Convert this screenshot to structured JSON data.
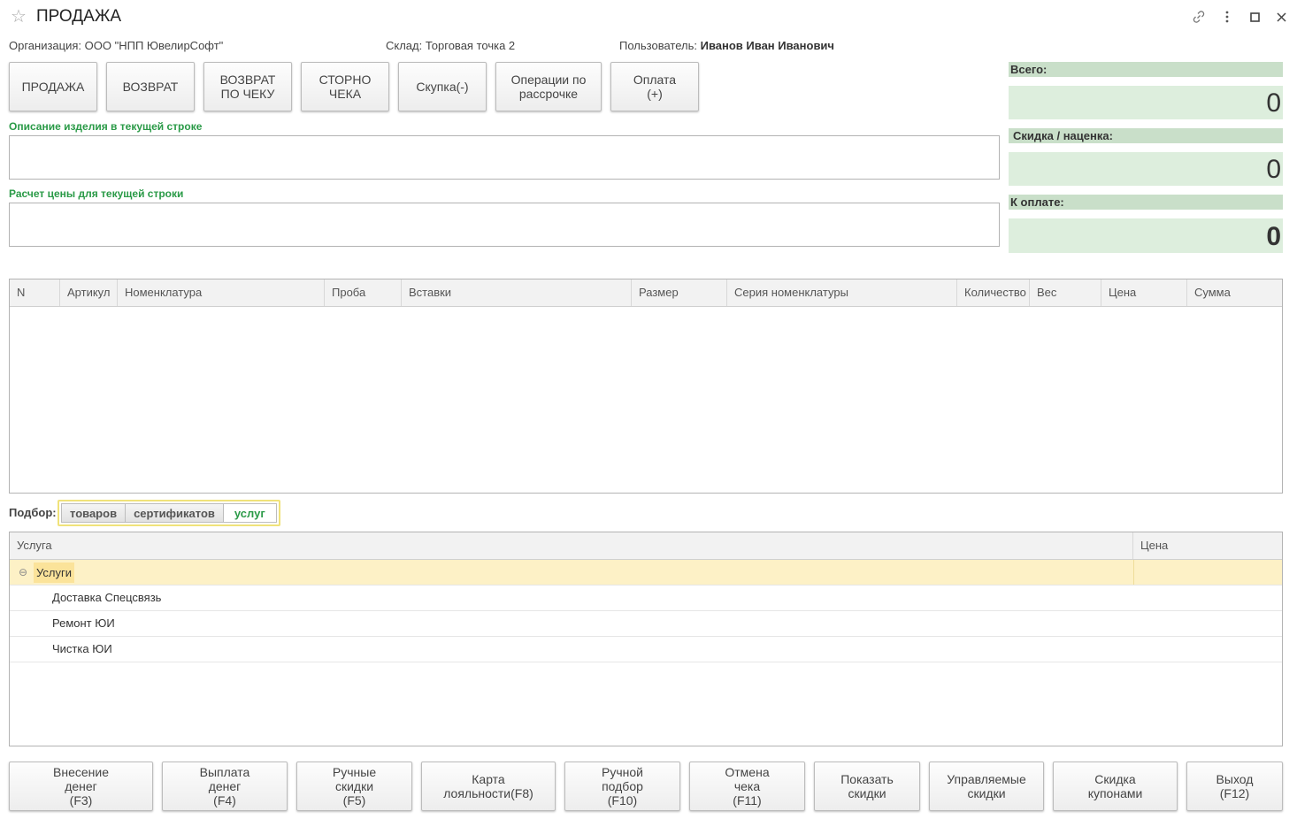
{
  "window": {
    "title": "ПРОДАЖА"
  },
  "info": {
    "org_label": "Организация:",
    "org_value": "ООО \"НПП ЮвелирСофт\"",
    "store_label": "Склад:",
    "store_value": "Торговая точка 2",
    "user_label": "Пользователь:",
    "user_value": "Иванов Иван Иванович"
  },
  "operations": [
    {
      "label": "ПРОДАЖА"
    },
    {
      "label": "ВОЗВРАТ"
    },
    {
      "label": "ВОЗВРАТ\nПО ЧЕКУ"
    },
    {
      "label": "СТОРНО\nЧЕКА"
    },
    {
      "label": "Скупка(-)"
    },
    {
      "label": "Операции по\nрассрочке"
    },
    {
      "label": "Оплата\n(+)"
    }
  ],
  "description": {
    "label": "Описание изделия в текущей строке",
    "value": ""
  },
  "price_calc": {
    "label": "Расчет цены для текущей строки",
    "value": ""
  },
  "totals": {
    "total_label": "Всего:",
    "total_value": "0",
    "discount_label": "Скидка / наценка:",
    "discount_value": "0",
    "to_pay_label": "К оплате:",
    "to_pay_value": "0"
  },
  "items_table": {
    "columns": [
      "N",
      "Артикул",
      "Номенклатура",
      "Проба",
      "Вставки",
      "Размер",
      "Серия номенклатуры",
      "Количество",
      "Вес",
      "Цена",
      "Сумма"
    ],
    "rows": []
  },
  "selection": {
    "label": "Подбор:",
    "tabs": [
      "товаров",
      "сертификатов",
      "услуг"
    ],
    "active_tab": "услуг"
  },
  "services_table": {
    "columns": [
      "Услуга",
      "Цена"
    ],
    "group": {
      "name": "Услуги",
      "expanded": true
    },
    "rows": [
      {
        "name": "Доставка Спецсвязь",
        "price": ""
      },
      {
        "name": "Ремонт ЮИ",
        "price": ""
      },
      {
        "name": "Чистка ЮИ",
        "price": ""
      }
    ]
  },
  "bottom_buttons": [
    {
      "label": "Внесение\nденег\n(F3)"
    },
    {
      "label": "Выплата\nденег\n(F4)"
    },
    {
      "label": "Ручные\nскидки\n(F5)"
    },
    {
      "label": "Карта\nлояльности(F8)"
    },
    {
      "label": "Ручной\nподбор\n(F10)"
    },
    {
      "label": "Отмена\nчека\n(F11)"
    },
    {
      "label": "Показать\nскидки"
    },
    {
      "label": "Управляемые\nскидки"
    },
    {
      "label": "Скидка\nкупонами"
    },
    {
      "label": "Выход\n(F12)"
    }
  ],
  "colors": {
    "green_label": "#2a9a47",
    "totals_header_bg": "#c9dfc9",
    "totals_value_bg": "#ddeedd",
    "group_row_bg": "#fdf1c6",
    "group_cell_bg": "#fbe39a",
    "selection_border": "#f0e27a"
  }
}
